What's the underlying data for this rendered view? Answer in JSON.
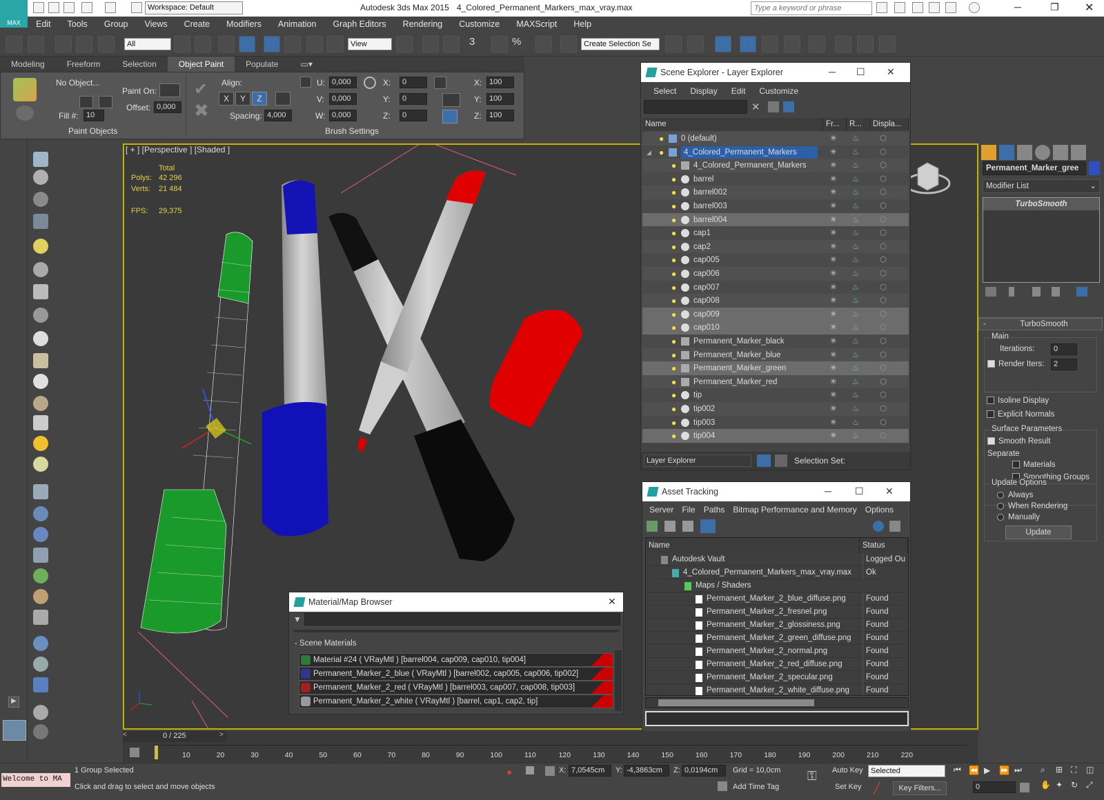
{
  "app": {
    "title": "Autodesk 3ds Max  2015",
    "file": "4_Colored_Permanent_Markers_max_vray.max",
    "workspace": "Workspace: Default",
    "search_placeholder": "Type a keyword or phrase",
    "logo": "MAX"
  },
  "menu": [
    "Edit",
    "Tools",
    "Group",
    "Views",
    "Create",
    "Modifiers",
    "Animation",
    "Graph Editors",
    "Rendering",
    "Customize",
    "MAXScript",
    "Help"
  ],
  "toolbar": {
    "filter": "All",
    "view": "View",
    "selset": "Create Selection Se",
    "snap3": "3",
    "snap_pct": "%"
  },
  "ribbon": {
    "tabs": [
      "Modeling",
      "Freeform",
      "Selection",
      "Object Paint",
      "Populate"
    ],
    "active": "Object Paint",
    "no_object": "No Object...",
    "fill_label": "Fill #:",
    "fill_value": "10",
    "paint_on": "Paint On:",
    "offset_label": "Offset:",
    "offset_value": "0,000",
    "paint_objects": "Paint Objects",
    "align": "Align:",
    "axes": [
      "X",
      "Y",
      "Z"
    ],
    "spacing_label": "Spacing:",
    "spacing_value": "4,000",
    "brush_settings": "Brush Settings",
    "u": "U:",
    "v": "V:",
    "w": "W:",
    "uvw_value": "0,000",
    "rx": "X:",
    "ry": "Y:",
    "rz": "Z:",
    "rot_value": "0",
    "sx": "X:",
    "sy": "Y:",
    "sz": "Z:",
    "scale_value": "100"
  },
  "viewport": {
    "label": "[ + ] [Perspective ] [Shaded ]",
    "total": "Total",
    "polys_label": "Polys:",
    "polys": "42 296",
    "verts_label": "Verts:",
    "verts": "21 484",
    "fps_label": "FPS:",
    "fps": "29,375"
  },
  "scene_explorer": {
    "title": "Scene Explorer - Layer Explorer",
    "menu": [
      "Select",
      "Display",
      "Edit",
      "Customize"
    ],
    "columns": [
      "Name",
      "Fr...",
      "R...",
      "Displa..."
    ],
    "rows": [
      {
        "name": "0 (default)",
        "indent": 1,
        "type": "layer",
        "sel": false,
        "hl": false
      },
      {
        "name": "4_Colored_Permanent_Markers",
        "indent": 1,
        "type": "layer",
        "sel": true,
        "hl": false
      },
      {
        "name": "4_Colored_Permanent_Markers",
        "indent": 2,
        "type": "group",
        "sel": false,
        "hl": false
      },
      {
        "name": "barrel",
        "indent": 2,
        "type": "obj",
        "sel": false,
        "hl": false
      },
      {
        "name": "barrel002",
        "indent": 2,
        "type": "obj",
        "sel": false,
        "hl": false
      },
      {
        "name": "barrel003",
        "indent": 2,
        "type": "obj",
        "sel": false,
        "hl": false
      },
      {
        "name": "barrel004",
        "indent": 2,
        "type": "obj",
        "sel": false,
        "hl": true
      },
      {
        "name": "cap1",
        "indent": 2,
        "type": "obj",
        "sel": false,
        "hl": false
      },
      {
        "name": "cap2",
        "indent": 2,
        "type": "obj",
        "sel": false,
        "hl": false
      },
      {
        "name": "cap005",
        "indent": 2,
        "type": "obj",
        "sel": false,
        "hl": false
      },
      {
        "name": "cap006",
        "indent": 2,
        "type": "obj",
        "sel": false,
        "hl": false
      },
      {
        "name": "cap007",
        "indent": 2,
        "type": "obj",
        "sel": false,
        "hl": false
      },
      {
        "name": "cap008",
        "indent": 2,
        "type": "obj",
        "sel": false,
        "hl": false
      },
      {
        "name": "cap009",
        "indent": 2,
        "type": "obj",
        "sel": false,
        "hl": true
      },
      {
        "name": "cap010",
        "indent": 2,
        "type": "obj",
        "sel": false,
        "hl": true
      },
      {
        "name": "Permanent_Marker_black",
        "indent": 2,
        "type": "group",
        "sel": false,
        "hl": false
      },
      {
        "name": "Permanent_Marker_blue",
        "indent": 2,
        "type": "group",
        "sel": false,
        "hl": false
      },
      {
        "name": "Permanent_Marker_green",
        "indent": 2,
        "type": "group",
        "sel": false,
        "hl": true
      },
      {
        "name": "Permanent_Marker_red",
        "indent": 2,
        "type": "group",
        "sel": false,
        "hl": false
      },
      {
        "name": "tip",
        "indent": 2,
        "type": "obj",
        "sel": false,
        "hl": false
      },
      {
        "name": "tip002",
        "indent": 2,
        "type": "obj",
        "sel": false,
        "hl": false
      },
      {
        "name": "tip003",
        "indent": 2,
        "type": "obj",
        "sel": false,
        "hl": false
      },
      {
        "name": "tip004",
        "indent": 2,
        "type": "obj",
        "sel": false,
        "hl": true
      }
    ],
    "footer_combo": "Layer Explorer",
    "selection_set": "Selection Set:"
  },
  "asset_tracking": {
    "title": "Asset Tracking",
    "menu": [
      "Server",
      "File",
      "Paths",
      "Bitmap Performance and Memory",
      "Options"
    ],
    "columns": [
      "Name",
      "Status"
    ],
    "rows": [
      {
        "name": "Autodesk Vault",
        "status": "Logged Ou",
        "level": 1
      },
      {
        "name": "4_Colored_Permanent_Markers_max_vray.max",
        "status": "Ok",
        "level": 2
      },
      {
        "name": "Maps / Shaders",
        "status": "",
        "level": 3
      },
      {
        "name": "Permanent_Marker_2_blue_diffuse.png",
        "status": "Found",
        "level": 4
      },
      {
        "name": "Permanent_Marker_2_fresnel.png",
        "status": "Found",
        "level": 4
      },
      {
        "name": "Permanent_Marker_2_glossiness.png",
        "status": "Found",
        "level": 4
      },
      {
        "name": "Permanent_Marker_2_green_diffuse.png",
        "status": "Found",
        "level": 4
      },
      {
        "name": "Permanent_Marker_2_normal.png",
        "status": "Found",
        "level": 4
      },
      {
        "name": "Permanent_Marker_2_red_diffuse.png",
        "status": "Found",
        "level": 4
      },
      {
        "name": "Permanent_Marker_2_specular.png",
        "status": "Found",
        "level": 4
      },
      {
        "name": "Permanent_Marker_2_white_diffuse.png",
        "status": "Found",
        "level": 4
      }
    ]
  },
  "material_browser": {
    "title": "Material/Map Browser",
    "group": "- Scene Materials",
    "items": [
      {
        "name": "Material #24  ( VRayMtl )  [barrel004, cap009, cap010, tip004]",
        "color": "#2f7a3a"
      },
      {
        "name": "Permanent_Marker_2_blue  ( VRayMtl )  [barrel002, cap005, cap006, tip002]",
        "color": "#34348c"
      },
      {
        "name": "Permanent_Marker_2_red  ( VRayMtl )  [barrel003, cap007, cap008, tip003]",
        "color": "#a02020"
      },
      {
        "name": "Permanent_Marker_2_white  ( VRayMtl )  [barrel, cap1, cap2, tip]",
        "color": "#9a9a9a"
      }
    ]
  },
  "command_panel": {
    "object_name": "Permanent_Marker_gree",
    "modifier_list": "Modifier List",
    "modifier": "TurboSmooth",
    "rollout": "TurboSmooth",
    "main": "Main",
    "iterations_label": "Iterations:",
    "iterations": "0",
    "render_iters_label": "Render Iters:",
    "render_iters": "2",
    "isoline": "Isoline Display",
    "explicit": "Explicit Normals",
    "surface": "Surface Parameters",
    "smooth_result": "Smooth Result",
    "separate": "Separate",
    "materials": "Materials",
    "smoothing_groups": "Smoothing Groups",
    "update_options": "Update Options",
    "always": "Always",
    "when_rendering": "When Rendering",
    "manually": "Manually",
    "update_btn": "Update"
  },
  "timeline": {
    "frame": "0 / 225",
    "ticks": [
      "10",
      "20",
      "30",
      "40",
      "50",
      "60",
      "70",
      "80",
      "90",
      "100",
      "110",
      "120",
      "130",
      "140",
      "150",
      "160",
      "170",
      "180",
      "190",
      "200",
      "210",
      "220"
    ]
  },
  "status": {
    "welcome": "Welcome to MA",
    "selected": "1 Group Selected",
    "prompt": "Click and drag to select and move objects",
    "x_label": "X:",
    "x": "7,0545cm",
    "y_label": "Y:",
    "y": "-4,3863cm",
    "z_label": "Z:",
    "z": "0,0194cm",
    "grid": "Grid = 10,0cm",
    "add_time_tag": "Add Time Tag",
    "auto_key": "Auto Key",
    "set_key": "Set Key",
    "key_mode": "Selected",
    "key_filters": "Key Filters...",
    "frame_value": "0"
  },
  "colors": {
    "accent": "#3c6ea8",
    "viewport_border": "#c8b000",
    "selected_row": "#2d5fa8"
  }
}
